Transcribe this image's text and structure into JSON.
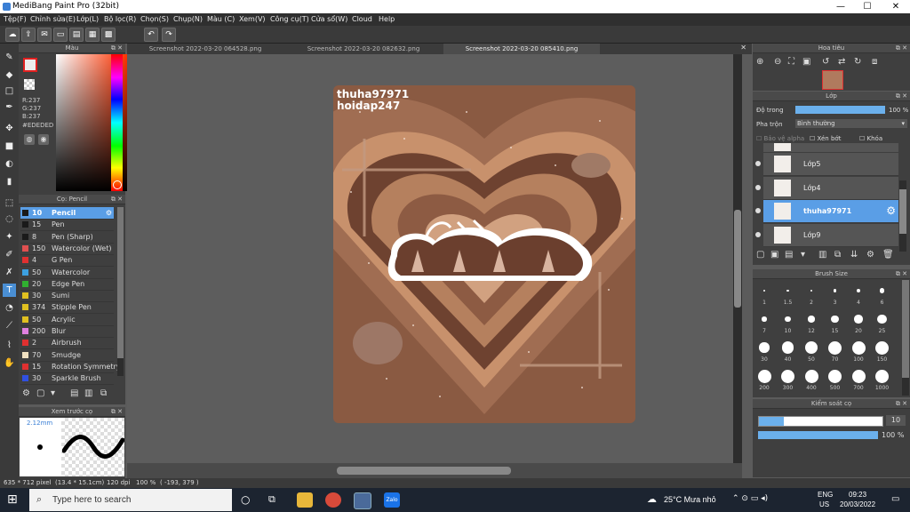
{
  "app": {
    "title": "MediBang Paint Pro (32bit)"
  },
  "window_controls": {
    "minimize": "—",
    "maximize": "☐",
    "close": "✕"
  },
  "menu": [
    "Tệp(F)",
    "Chỉnh sửa(E)",
    "Lớp(L)",
    "Bộ lọc(R)",
    "Chọn(S)",
    "Chụp(N)",
    "Màu (C)",
    "Xem(V)",
    "Công cụ(T)",
    "Cửa sổ(W)",
    "Cloud",
    "Help"
  ],
  "color_panel": {
    "title": "Màu",
    "r": "R:237",
    "g": "G:237",
    "b": "B:237",
    "hex": "#EDEDED"
  },
  "brush_panel": {
    "title": "Cọ: Pencil",
    "brushes": [
      {
        "size": "10",
        "name": "Pencil",
        "color": "#1a1a1a",
        "selected": true
      },
      {
        "size": "15",
        "name": "Pen",
        "color": "#1a1a1a"
      },
      {
        "size": "8",
        "name": "Pen (Sharp)",
        "color": "#1a1a1a"
      },
      {
        "size": "150",
        "name": "Watercolor (Wet)",
        "color": "#e05050"
      },
      {
        "size": "4",
        "name": "G Pen",
        "color": "#e03030"
      },
      {
        "size": "50",
        "name": "Watercolor",
        "color": "#3ca0e0"
      },
      {
        "size": "20",
        "name": "Edge Pen",
        "color": "#30b030"
      },
      {
        "size": "30",
        "name": "Sumi",
        "color": "#e0c020"
      },
      {
        "size": "374",
        "name": "Stipple Pen",
        "color": "#e0c020"
      },
      {
        "size": "50",
        "name": "Acrylic",
        "color": "#e0c020"
      },
      {
        "size": "200",
        "name": "Blur",
        "color": "#e080e0"
      },
      {
        "size": "2",
        "name": "Airbrush",
        "color": "#e03030"
      },
      {
        "size": "70",
        "name": "Smudge",
        "color": "#f0e0c0"
      },
      {
        "size": "15",
        "name": "Rotation Symmetry",
        "color": "#e03030"
      },
      {
        "size": "30",
        "name": "Sparkle Brush",
        "color": "#3050e0"
      }
    ]
  },
  "preview_panel": {
    "title": "Xem trước cọ",
    "size": "2.12mm"
  },
  "tabs": [
    "Screenshot 2022-03-20 064528.png",
    "Screenshot 2022-03-20 082632.png",
    "Screenshot 2022-03-20 085410.png"
  ],
  "artwork": {
    "watermark1": "thuha97971",
    "watermark2": "hoidap247",
    "word": "ơììn"
  },
  "navigator": {
    "title": "Hoa tiêu"
  },
  "layer_panel": {
    "title": "Lớp",
    "opacity_label": "Độ trong",
    "opacity_value": "100 %",
    "opacity": 1.0,
    "blend_label": "Pha trộn",
    "blend_value": "Bình thường",
    "protect_alpha": "Bảo vệ alpha",
    "clipping": "Xén bớt",
    "lock": "Khóa",
    "layers": [
      {
        "name": "Lớp5"
      },
      {
        "name": "Lớp4"
      },
      {
        "name": "thuha97971",
        "selected": true
      },
      {
        "name": "Lớp9"
      }
    ]
  },
  "brush_size_panel": {
    "title": "Brush Size",
    "sizes": [
      "1",
      "1.5",
      "2",
      "3",
      "4",
      "6",
      "7",
      "10",
      "12",
      "15",
      "20",
      "25",
      "30",
      "40",
      "50",
      "70",
      "100",
      "150",
      "200",
      "300",
      "400",
      "500",
      "700",
      "1000"
    ]
  },
  "control_panel": {
    "title": "Kiểm soát cọ",
    "size_value": "10",
    "size_fraction": 0.2,
    "opacity_value": "100 %",
    "opacity": 1.0
  },
  "status": {
    "dims": "635 * 712 pixel",
    "physical": "(13.4 * 15.1cm)",
    "dpi": "120 dpi",
    "zoom": "100 %",
    "coords": "( -193, 379 )"
  },
  "taskbar": {
    "search_placeholder": "Type here to search",
    "weather": "25°C  Mưa nhỏ",
    "lang1": "ENG",
    "lang2": "US",
    "time": "09:23",
    "date": "20/03/2022",
    "zalo": "Zalo"
  }
}
